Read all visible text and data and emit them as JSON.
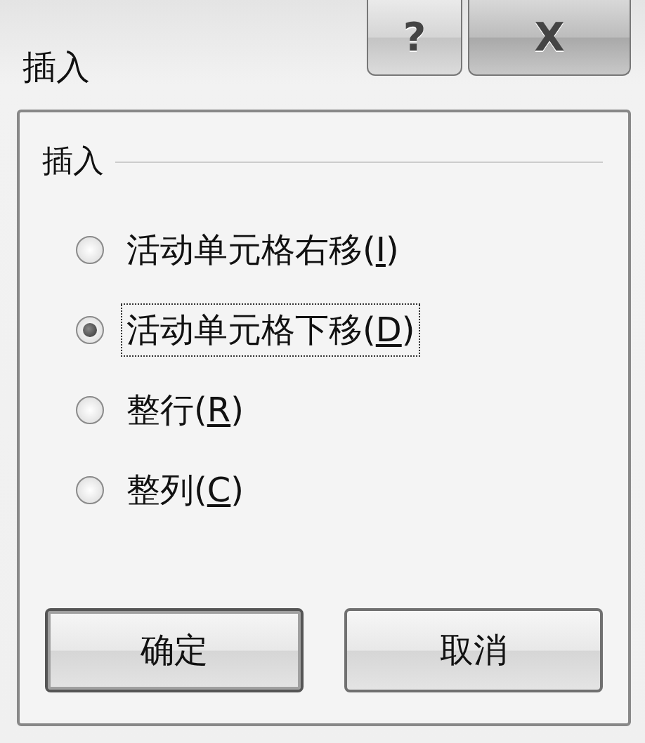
{
  "window": {
    "title": "插入",
    "help_button": "?",
    "close_button": "X"
  },
  "group": {
    "title": "插入",
    "options": [
      {
        "text_before": "活动单元格右移(",
        "access_key": "I",
        "text_after": ")",
        "selected": false,
        "focused": false
      },
      {
        "text_before": "活动单元格下移(",
        "access_key": "D",
        "text_after": ")",
        "selected": true,
        "focused": true
      },
      {
        "text_before": "整行(",
        "access_key": "R",
        "text_after": ")",
        "selected": false,
        "focused": false
      },
      {
        "text_before": "整列(",
        "access_key": "C",
        "text_after": ")",
        "selected": false,
        "focused": false
      }
    ]
  },
  "buttons": [
    "确定",
    "取消"
  ]
}
